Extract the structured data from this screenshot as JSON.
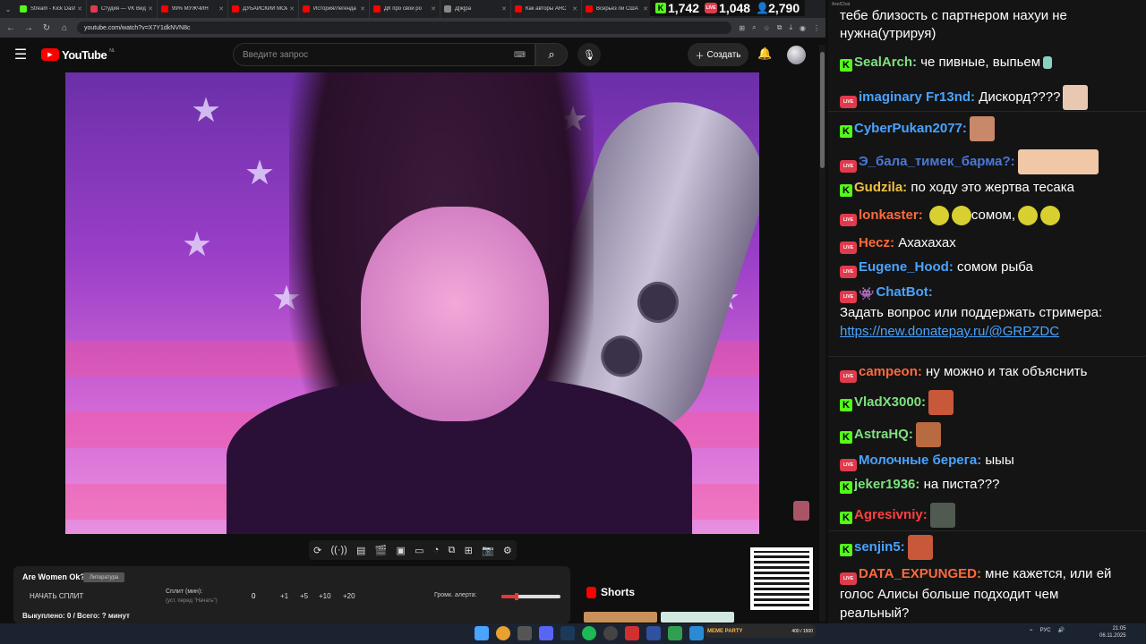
{
  "browser": {
    "tabs": [
      {
        "title": "Stream - Kick Dash",
        "color": "#53fc18"
      },
      {
        "title": "Студия — VK Видео",
        "color": "#e03b4d"
      },
      {
        "title": "99% МУЖЧИН",
        "color": "#f00"
      },
      {
        "title": "ДУБАЙСКИЙ МОЙ",
        "color": "#f00"
      },
      {
        "title": "История/Легенда",
        "color": "#f00"
      },
      {
        "title": "ДК про свой ро",
        "color": "#f00"
      },
      {
        "title": "Д[ж]ра",
        "color": "#888"
      },
      {
        "title": "Как авторы ARC",
        "color": "#f00"
      },
      {
        "title": "Всерьез ли США",
        "color": "#f00"
      }
    ],
    "url": "youtube.com/watch?v=X7Y1dkNVN8c"
  },
  "stats": {
    "kick_viewers": "1,742",
    "vk_viewers": "1,048",
    "total_viewers": "2,790"
  },
  "youtube": {
    "logo": "YouTube",
    "region": "NL",
    "search_placeholder": "Введите запрос",
    "create_label": "Создать"
  },
  "widget": {
    "title": "Are Women Ok?",
    "badge": "Литература",
    "start_label": "НАЧАТЬ СПЛИТ",
    "split_label": "Сплит (мин):",
    "split_sub": "(уст. перед \"Начать\")",
    "split_value": "0",
    "increments": [
      "+1",
      "+5",
      "+10",
      "+20"
    ],
    "volume_label": "Громк. алерта:",
    "volume_level": 0.25,
    "bought": "Выкуплено: 0 / Всего: ? минут"
  },
  "shorts": {
    "label": "Shorts"
  },
  "chat": {
    "window_title": "AxelChat",
    "messages": [
      {
        "platform": "none",
        "nick": "",
        "text": "тебе близость с партнером нахуи не нужна(утрируя)",
        "nick_color": "#ffffff",
        "emote": ""
      },
      {
        "platform": "kick",
        "nick": "SealArch:",
        "text": "че пивные, выпьем",
        "nick_color": "#7ee07e",
        "emote": "#8ad0c0"
      },
      {
        "platform": "vk",
        "nick": "imaginary Fr13nd:",
        "text": "Дискорд????",
        "nick_color": "#4aa3ff",
        "emote": "#e8c8b0"
      },
      {
        "platform": "kick",
        "nick": "CyberPukan2077:",
        "text": "",
        "nick_color": "#4aa3ff",
        "emote": "#c8886a"
      },
      {
        "platform": "vk",
        "nick": "Э_бала_тимек_барма?:",
        "text": "",
        "nick_color": "#4a78d8",
        "emote": "#f0c8a8"
      },
      {
        "platform": "kick",
        "nick": "Gudzila:",
        "text": "по ходу это жертва тесака",
        "nick_color": "#f0c040",
        "emote": ""
      },
      {
        "platform": "vk",
        "nick": "lonkaster:",
        "text": "сомом,",
        "nick_color": "#ff6a3d",
        "emote": "#d8d030"
      },
      {
        "platform": "vk",
        "nick": "Hecz:",
        "text": "Ахахахах",
        "nick_color": "#ff6a3d",
        "emote": ""
      },
      {
        "platform": "vk",
        "nick": "Eugene_Hood:",
        "text": "сомом рыба",
        "nick_color": "#4aa3ff",
        "emote": ""
      },
      {
        "platform": "vk",
        "nick": "ChatBot:",
        "text": "Задать вопрос или поддержать стримера:",
        "nick_color": "#4aa3ff",
        "emote": ""
      },
      {
        "platform": "vk",
        "nick": "campeon:",
        "text": "ну можно и так объяснить",
        "nick_color": "#ff6a3d",
        "emote": ""
      },
      {
        "platform": "kick",
        "nick": "VladX3000:",
        "text": "",
        "nick_color": "#7ee07e",
        "emote": "#c8583a"
      },
      {
        "platform": "kick",
        "nick": "AstraHQ:",
        "text": "",
        "nick_color": "#7ee07e",
        "emote": "#b86a40"
      },
      {
        "platform": "vk",
        "nick": "Молочные берега:",
        "text": "ыыы",
        "nick_color": "#4aa3ff",
        "emote": ""
      },
      {
        "platform": "kick",
        "nick": "jeker1936:",
        "text": "на писта???",
        "nick_color": "#7ee07e",
        "emote": ""
      },
      {
        "platform": "kick",
        "nick": "Agresivniy:",
        "text": "",
        "nick_color": "#ff4040",
        "emote": "#505a50"
      },
      {
        "platform": "kick",
        "nick": "senjin5:",
        "text": "",
        "nick_color": "#4aa3ff",
        "emote": "#c8583a"
      },
      {
        "platform": "vk",
        "nick": "DATA_EXPUNGED:",
        "text": "мне кажется, или ей голос Алисы больше подходит чем реальный?",
        "nick_color": "#ff6a3d",
        "emote": ""
      }
    ],
    "donate_link": "https://new.donatepay.ru/@GRPZDC"
  },
  "gamebar": {
    "title": "MEME PARTY",
    "count": "400 / 1500"
  },
  "taskbar": {
    "lang": "РУС",
    "time": "21:05",
    "date": "06.11.2025"
  }
}
